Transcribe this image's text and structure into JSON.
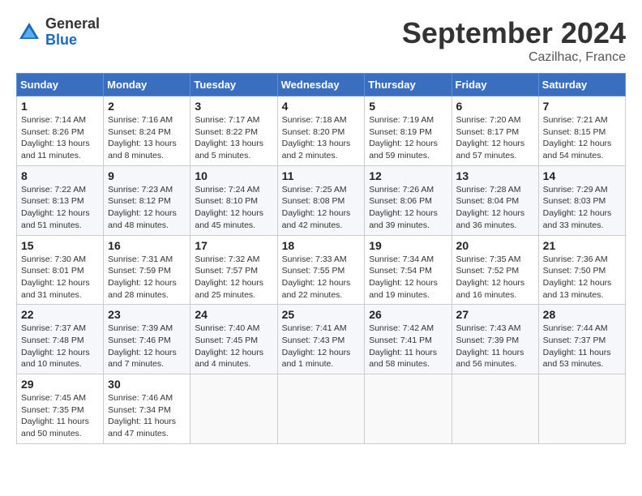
{
  "header": {
    "logo_general": "General",
    "logo_blue": "Blue",
    "month_title": "September 2024",
    "location": "Cazilhac, France"
  },
  "weekdays": [
    "Sunday",
    "Monday",
    "Tuesday",
    "Wednesday",
    "Thursday",
    "Friday",
    "Saturday"
  ],
  "weeks": [
    [
      {
        "day": "1",
        "sunrise": "Sunrise: 7:14 AM",
        "sunset": "Sunset: 8:26 PM",
        "daylight": "Daylight: 13 hours and 11 minutes."
      },
      {
        "day": "2",
        "sunrise": "Sunrise: 7:16 AM",
        "sunset": "Sunset: 8:24 PM",
        "daylight": "Daylight: 13 hours and 8 minutes."
      },
      {
        "day": "3",
        "sunrise": "Sunrise: 7:17 AM",
        "sunset": "Sunset: 8:22 PM",
        "daylight": "Daylight: 13 hours and 5 minutes."
      },
      {
        "day": "4",
        "sunrise": "Sunrise: 7:18 AM",
        "sunset": "Sunset: 8:20 PM",
        "daylight": "Daylight: 13 hours and 2 minutes."
      },
      {
        "day": "5",
        "sunrise": "Sunrise: 7:19 AM",
        "sunset": "Sunset: 8:19 PM",
        "daylight": "Daylight: 12 hours and 59 minutes."
      },
      {
        "day": "6",
        "sunrise": "Sunrise: 7:20 AM",
        "sunset": "Sunset: 8:17 PM",
        "daylight": "Daylight: 12 hours and 57 minutes."
      },
      {
        "day": "7",
        "sunrise": "Sunrise: 7:21 AM",
        "sunset": "Sunset: 8:15 PM",
        "daylight": "Daylight: 12 hours and 54 minutes."
      }
    ],
    [
      {
        "day": "8",
        "sunrise": "Sunrise: 7:22 AM",
        "sunset": "Sunset: 8:13 PM",
        "daylight": "Daylight: 12 hours and 51 minutes."
      },
      {
        "day": "9",
        "sunrise": "Sunrise: 7:23 AM",
        "sunset": "Sunset: 8:12 PM",
        "daylight": "Daylight: 12 hours and 48 minutes."
      },
      {
        "day": "10",
        "sunrise": "Sunrise: 7:24 AM",
        "sunset": "Sunset: 8:10 PM",
        "daylight": "Daylight: 12 hours and 45 minutes."
      },
      {
        "day": "11",
        "sunrise": "Sunrise: 7:25 AM",
        "sunset": "Sunset: 8:08 PM",
        "daylight": "Daylight: 12 hours and 42 minutes."
      },
      {
        "day": "12",
        "sunrise": "Sunrise: 7:26 AM",
        "sunset": "Sunset: 8:06 PM",
        "daylight": "Daylight: 12 hours and 39 minutes."
      },
      {
        "day": "13",
        "sunrise": "Sunrise: 7:28 AM",
        "sunset": "Sunset: 8:04 PM",
        "daylight": "Daylight: 12 hours and 36 minutes."
      },
      {
        "day": "14",
        "sunrise": "Sunrise: 7:29 AM",
        "sunset": "Sunset: 8:03 PM",
        "daylight": "Daylight: 12 hours and 33 minutes."
      }
    ],
    [
      {
        "day": "15",
        "sunrise": "Sunrise: 7:30 AM",
        "sunset": "Sunset: 8:01 PM",
        "daylight": "Daylight: 12 hours and 31 minutes."
      },
      {
        "day": "16",
        "sunrise": "Sunrise: 7:31 AM",
        "sunset": "Sunset: 7:59 PM",
        "daylight": "Daylight: 12 hours and 28 minutes."
      },
      {
        "day": "17",
        "sunrise": "Sunrise: 7:32 AM",
        "sunset": "Sunset: 7:57 PM",
        "daylight": "Daylight: 12 hours and 25 minutes."
      },
      {
        "day": "18",
        "sunrise": "Sunrise: 7:33 AM",
        "sunset": "Sunset: 7:55 PM",
        "daylight": "Daylight: 12 hours and 22 minutes."
      },
      {
        "day": "19",
        "sunrise": "Sunrise: 7:34 AM",
        "sunset": "Sunset: 7:54 PM",
        "daylight": "Daylight: 12 hours and 19 minutes."
      },
      {
        "day": "20",
        "sunrise": "Sunrise: 7:35 AM",
        "sunset": "Sunset: 7:52 PM",
        "daylight": "Daylight: 12 hours and 16 minutes."
      },
      {
        "day": "21",
        "sunrise": "Sunrise: 7:36 AM",
        "sunset": "Sunset: 7:50 PM",
        "daylight": "Daylight: 12 hours and 13 minutes."
      }
    ],
    [
      {
        "day": "22",
        "sunrise": "Sunrise: 7:37 AM",
        "sunset": "Sunset: 7:48 PM",
        "daylight": "Daylight: 12 hours and 10 minutes."
      },
      {
        "day": "23",
        "sunrise": "Sunrise: 7:39 AM",
        "sunset": "Sunset: 7:46 PM",
        "daylight": "Daylight: 12 hours and 7 minutes."
      },
      {
        "day": "24",
        "sunrise": "Sunrise: 7:40 AM",
        "sunset": "Sunset: 7:45 PM",
        "daylight": "Daylight: 12 hours and 4 minutes."
      },
      {
        "day": "25",
        "sunrise": "Sunrise: 7:41 AM",
        "sunset": "Sunset: 7:43 PM",
        "daylight": "Daylight: 12 hours and 1 minute."
      },
      {
        "day": "26",
        "sunrise": "Sunrise: 7:42 AM",
        "sunset": "Sunset: 7:41 PM",
        "daylight": "Daylight: 11 hours and 58 minutes."
      },
      {
        "day": "27",
        "sunrise": "Sunrise: 7:43 AM",
        "sunset": "Sunset: 7:39 PM",
        "daylight": "Daylight: 11 hours and 56 minutes."
      },
      {
        "day": "28",
        "sunrise": "Sunrise: 7:44 AM",
        "sunset": "Sunset: 7:37 PM",
        "daylight": "Daylight: 11 hours and 53 minutes."
      }
    ],
    [
      {
        "day": "29",
        "sunrise": "Sunrise: 7:45 AM",
        "sunset": "Sunset: 7:35 PM",
        "daylight": "Daylight: 11 hours and 50 minutes."
      },
      {
        "day": "30",
        "sunrise": "Sunrise: 7:46 AM",
        "sunset": "Sunset: 7:34 PM",
        "daylight": "Daylight: 11 hours and 47 minutes."
      },
      null,
      null,
      null,
      null,
      null
    ]
  ]
}
